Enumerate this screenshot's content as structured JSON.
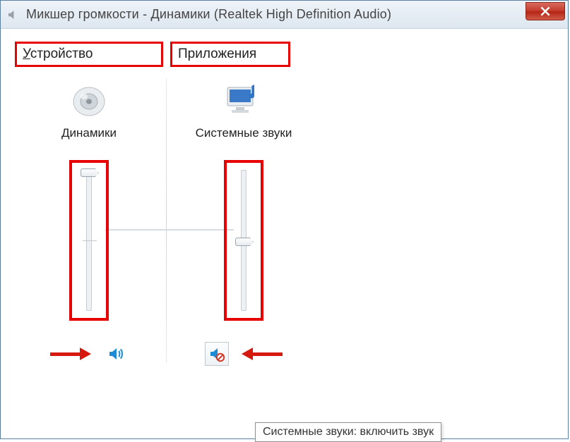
{
  "window": {
    "title": "Микшер громкости - Динамики (Realtek High Definition Audio)"
  },
  "headers": {
    "device_first_char": "У",
    "device_rest": "стройство",
    "apps": "Приложения"
  },
  "device": {
    "label": "Динамики",
    "volume_percent": 100,
    "muted": false
  },
  "apps": [
    {
      "label": "Системные звуки",
      "volume_percent": 50,
      "muted": true
    }
  ],
  "tooltip": "Системные звуки: включить звук"
}
